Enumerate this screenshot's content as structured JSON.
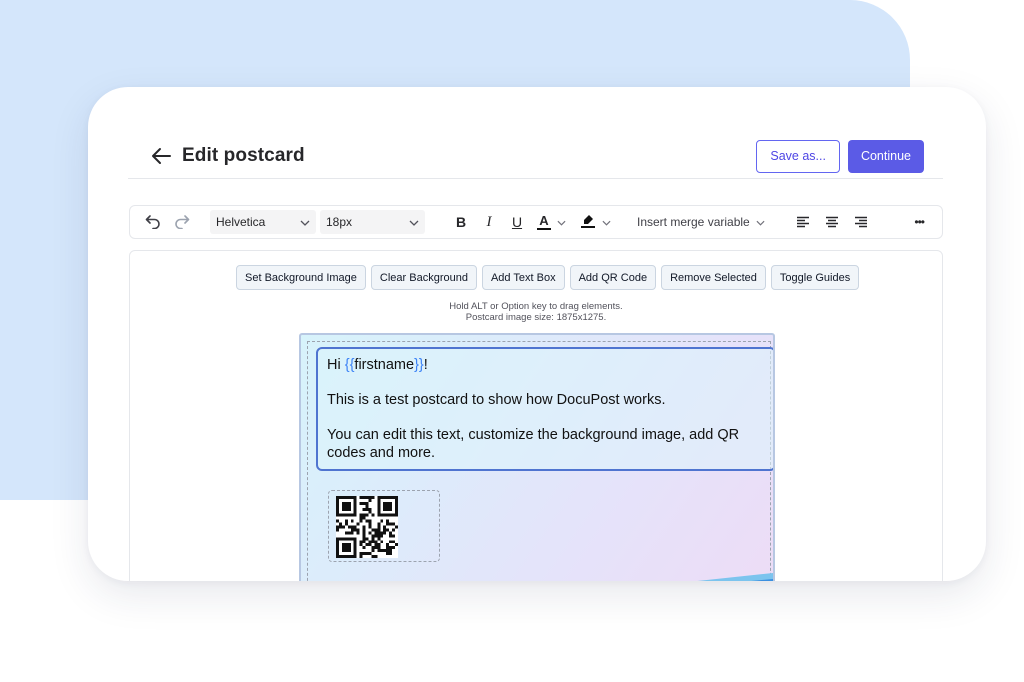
{
  "header": {
    "title": "Edit postcard",
    "save_as_label": "Save as...",
    "continue_label": "Continue"
  },
  "toolbar": {
    "font_family": "Helvetica",
    "font_size": "18px",
    "bold": "B",
    "italic": "I",
    "underline": "U",
    "text_color_glyph": "A",
    "merge_variable": "Insert merge variable",
    "more": "•••"
  },
  "actions": [
    "Set Background Image",
    "Clear Background",
    "Add Text Box",
    "Add QR Code",
    "Remove Selected",
    "Toggle Guides"
  ],
  "hints": {
    "line1": "Hold ALT or Option key to drag elements.",
    "line2": "Postcard image size: 1875x1275."
  },
  "postcard": {
    "greeting_prefix": "Hi ",
    "merge_open": "{{",
    "merge_name": "firstname",
    "merge_close": "}}",
    "greeting_suffix": "!",
    "paragraph1": "This is a test postcard to show how DocuPost works.",
    "paragraph2": "You can edit this text, customize the background image, add QR codes and more."
  },
  "colors": {
    "accent": "#5b5be6",
    "accent_border": "#6366f1",
    "backdrop": "#d4e6fb",
    "merge_variable": "#3b82f6",
    "text_box_border": "#4f74d0"
  },
  "icons": [
    "back-arrow-icon",
    "undo-icon",
    "redo-icon",
    "chevron-down-icon",
    "text-color-icon",
    "highlight-icon",
    "align-left-icon",
    "align-center-icon",
    "align-right-icon",
    "more-icon",
    "qr-code-icon"
  ]
}
